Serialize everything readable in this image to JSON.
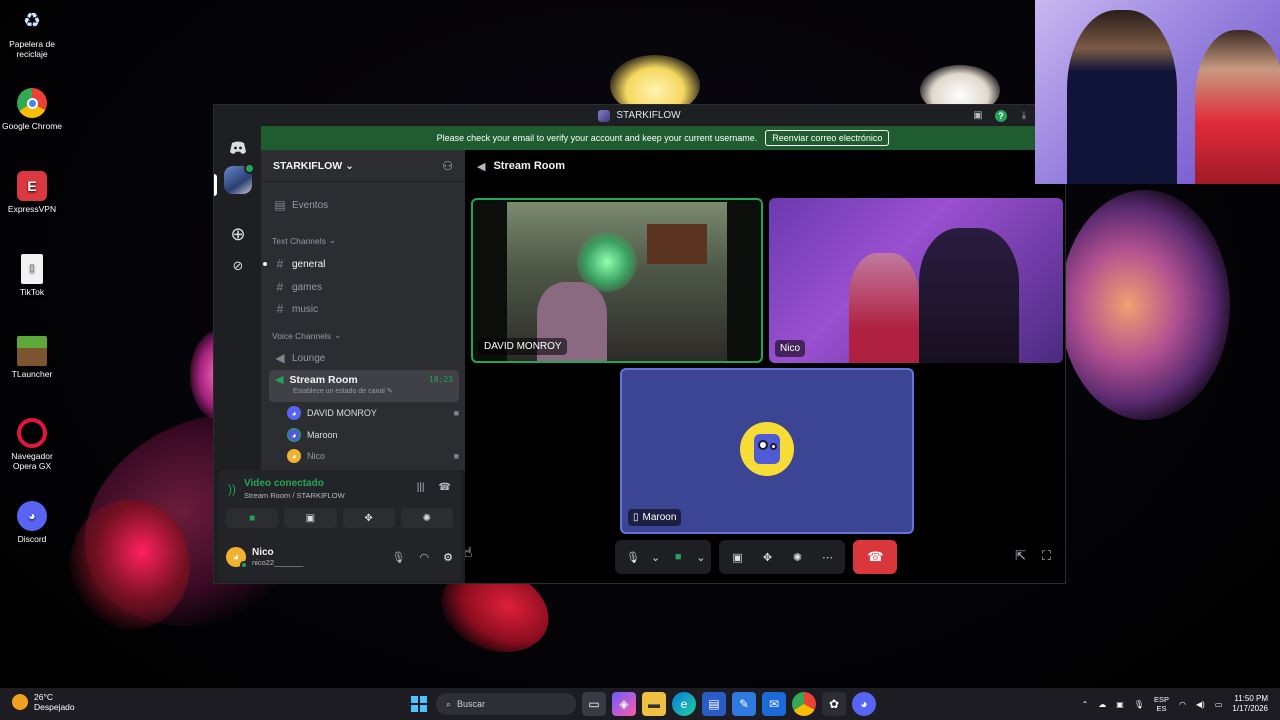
{
  "desktop": {
    "icons": [
      {
        "label": "Papelera de reciclaje",
        "icon": "recycle-bin-icon"
      },
      {
        "label": "Google Chrome",
        "icon": "chrome-icon"
      },
      {
        "label": "ExpressVPN",
        "icon": "expressvpn-icon"
      },
      {
        "label": "TikTok",
        "icon": "tiktok-icon"
      },
      {
        "label": "TLauncher",
        "icon": "tlauncher-icon"
      },
      {
        "label": "Navegador Opera GX",
        "icon": "opera-gx-icon"
      },
      {
        "label": "Discord",
        "icon": "discord-icon"
      }
    ]
  },
  "window": {
    "title": "STARKIFLOW",
    "banner_text": "Please check your email to verify your account and keep your current username.",
    "banner_button": "Reenviar correo electrónico"
  },
  "server": {
    "name": "STARKIFLOW",
    "events_label": "Eventos",
    "text_category": "Text Channels",
    "text_channels": [
      "general",
      "games",
      "music"
    ],
    "voice_category": "Voice Channels",
    "voice_channels": [
      "Lounge",
      "Stream Room"
    ],
    "active_channel": {
      "name": "Stream Room",
      "time": "18:23",
      "status_placeholder": "Establece un estado de canal"
    },
    "members": [
      {
        "name": "DAVID MONROY",
        "camera": true
      },
      {
        "name": "Maroon",
        "camera": false
      },
      {
        "name": "Nico",
        "camera": true
      }
    ]
  },
  "voice_panel": {
    "status": "Video conectado",
    "location": "Stream Room / STARKIFLOW"
  },
  "user": {
    "name": "Nico",
    "tag": "nico22_______"
  },
  "main": {
    "channel_title": "Stream Room",
    "tiles": [
      {
        "label": "DAVID MONROY"
      },
      {
        "label": "Nico"
      },
      {
        "label": "Maroon"
      }
    ]
  },
  "taskbar": {
    "weather_temp": "26°C",
    "weather_desc": "Despejado",
    "search_placeholder": "Buscar",
    "lang_top": "ESP",
    "lang_bottom": "ES",
    "time": "11:50 PM",
    "date": "1/17/2026"
  },
  "colors": {
    "accent_green": "#23a559",
    "end_call_red": "#da373c",
    "banner_green": "#1f5c2f",
    "blurple": "#5865f2"
  }
}
